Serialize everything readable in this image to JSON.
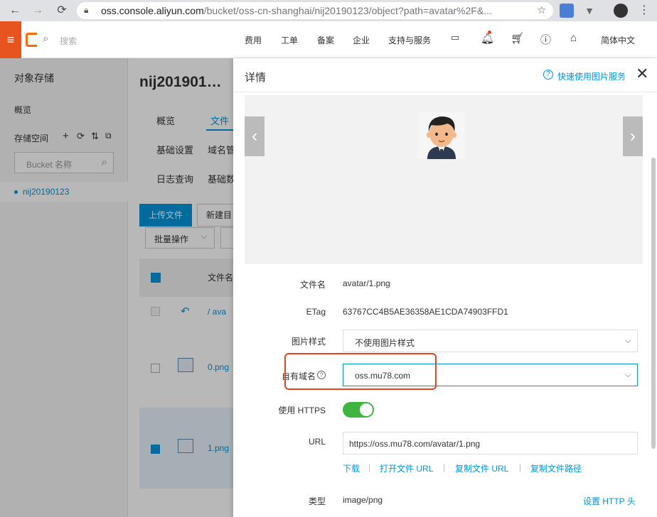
{
  "browser": {
    "url_host": "oss.console.aliyun.com",
    "url_path": "/bucket/oss-cn-shanghai/nij20190123/object?path=avatar%2F&..."
  },
  "topnav": {
    "search_placeholder": "搜索",
    "items": [
      "费用",
      "工单",
      "备案",
      "企业",
      "支持与服务"
    ],
    "language": "简体中文"
  },
  "sidebar": {
    "title": "对象存储",
    "overview": "概览",
    "buckets_label": "存储空间",
    "bucket_search_placeholder": "Bucket 名称",
    "bucket_item": "nij20190123"
  },
  "main": {
    "bucket_title": "nij201901…",
    "tabs_row1": [
      "概览",
      "文件"
    ],
    "tabs_row2": [
      "基础设置",
      "域名管"
    ],
    "tabs_row3": [
      "日志查询",
      "基础数"
    ],
    "upload_button": "上传文件",
    "new_dir_button": "新建目",
    "batch_button": "批量操作",
    "column_filename": "文件名",
    "parent_row": "/ ava",
    "files": [
      "0.png",
      "1.png"
    ]
  },
  "drawer": {
    "title": "详情",
    "help_link": "快速使用图片服务",
    "filename_label": "文件名",
    "filename_value": "avatar/1.png",
    "etag_label": "ETag",
    "etag_value": "63767CC4B5AE36358AE1CDA74903FFD1",
    "style_label": "图片样式",
    "style_value": "不使用图片样式",
    "domain_label": "自有域名",
    "domain_value": "oss.mu78.com",
    "https_label": "使用 HTTPS",
    "https_enabled": true,
    "url_label": "URL",
    "url_value": "https://oss.mu78.com/avatar/1.png",
    "actions": [
      "下载",
      "打开文件 URL",
      "复制文件 URL",
      "复制文件路径"
    ],
    "type_label": "类型",
    "type_value": "image/png",
    "set_http_header": "设置 HTTP 头"
  },
  "colors": {
    "accent": "#0095d9",
    "brand": "#ff6a00",
    "toggle_on": "#3fb43f",
    "highlight": "#e8431f"
  }
}
